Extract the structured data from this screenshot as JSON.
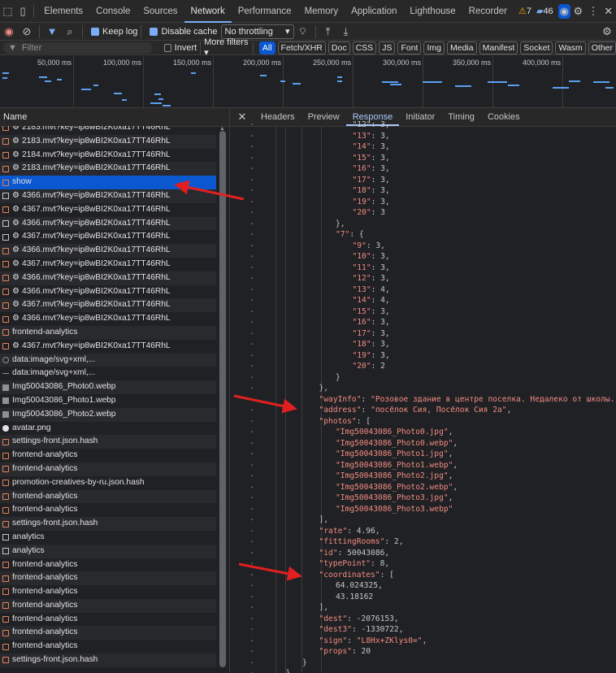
{
  "devtools": {
    "tabs": [
      "Elements",
      "Console",
      "Sources",
      "Network",
      "Performance",
      "Memory",
      "Application",
      "Lighthouse",
      "Recorder"
    ],
    "active_tab": "Network",
    "warnings_count": "7",
    "messages_count": "46"
  },
  "toolbar": {
    "preserve_log": "Keep log",
    "disable_cache": "Disable cache",
    "throttling": "No throttling"
  },
  "filterbar": {
    "placeholder": "Filter",
    "invert": "Invert",
    "more_filters": "More filters",
    "types": [
      "All",
      "Fetch/XHR",
      "Doc",
      "CSS",
      "JS",
      "Font",
      "Img",
      "Media",
      "Manifest",
      "Socket",
      "Wasm",
      "Other"
    ]
  },
  "overview": {
    "ticks": [
      "50,000 ms",
      "100,000 ms",
      "150,000 ms",
      "200,000 ms",
      "250,000 ms",
      "300,000 ms",
      "350,000 ms",
      "400,000 ms"
    ]
  },
  "requests": {
    "header": "Name",
    "rows": [
      {
        "icon": "code",
        "name": "⚙ 2183.mvt?key=ip8wBI2K0xa17TT46RhL"
      },
      {
        "icon": "code",
        "name": "⚙ 2183.mvt?key=ip8wBI2K0xa17TT46RhL"
      },
      {
        "icon": "code",
        "name": "⚙ 2184.mvt?key=ip8wBI2K0xa17TT46RhL"
      },
      {
        "icon": "code",
        "name": "⚙ 2183.mvt?key=ip8wBI2K0xa17TT46RhL"
      },
      {
        "icon": "code",
        "name": "show"
      },
      {
        "icon": "doc",
        "name": "⚙ 4366.mvt?key=ip8wBI2K0xa17TT46RhL"
      },
      {
        "icon": "code",
        "name": "⚙ 4367.mvt?key=ip8wBI2K0xa17TT46RhL"
      },
      {
        "icon": "doc",
        "name": "⚙ 4366.mvt?key=ip8wBI2K0xa17TT46RhL"
      },
      {
        "icon": "doc",
        "name": "⚙ 4367.mvt?key=ip8wBI2K0xa17TT46RhL"
      },
      {
        "icon": "code",
        "name": "⚙ 4366.mvt?key=ip8wBI2K0xa17TT46RhL"
      },
      {
        "icon": "code",
        "name": "⚙ 4367.mvt?key=ip8wBI2K0xa17TT46RhL"
      },
      {
        "icon": "code",
        "name": "⚙ 4366.mvt?key=ip8wBI2K0xa17TT46RhL"
      },
      {
        "icon": "code",
        "name": "⚙ 4366.mvt?key=ip8wBI2K0xa17TT46RhL"
      },
      {
        "icon": "code",
        "name": "⚙ 4367.mvt?key=ip8wBI2K0xa17TT46RhL"
      },
      {
        "icon": "code",
        "name": "⚙ 4366.mvt?key=ip8wBI2K0xa17TT46RhL"
      },
      {
        "icon": "code",
        "name": "frontend-analytics"
      },
      {
        "icon": "code",
        "name": "⚙ 4367.mvt?key=ip8wBI2K0xa17TT46RhL"
      },
      {
        "icon": "data",
        "name": "data:image/svg+xml,..."
      },
      {
        "icon": "dash",
        "name": "data:image/svg+xml,..."
      },
      {
        "icon": "img",
        "name": "Img50043086_Photo0.webp"
      },
      {
        "icon": "img",
        "name": "Img50043086_Photo1.webp"
      },
      {
        "icon": "img",
        "name": "Img50043086_Photo2.webp"
      },
      {
        "icon": "avatar",
        "name": "avatar.png"
      },
      {
        "icon": "code",
        "name": "settings-front.json.hash"
      },
      {
        "icon": "code",
        "name": "frontend-analytics"
      },
      {
        "icon": "code",
        "name": "frontend-analytics"
      },
      {
        "icon": "code",
        "name": "promotion-creatives-by-ru.json.hash"
      },
      {
        "icon": "code",
        "name": "frontend-analytics"
      },
      {
        "icon": "code",
        "name": "frontend-analytics"
      },
      {
        "icon": "code",
        "name": "settings-front.json.hash"
      },
      {
        "icon": "doc",
        "name": "analytics"
      },
      {
        "icon": "doc",
        "name": "analytics"
      },
      {
        "icon": "code",
        "name": "frontend-analytics"
      },
      {
        "icon": "code",
        "name": "frontend-analytics"
      },
      {
        "icon": "code",
        "name": "frontend-analytics"
      },
      {
        "icon": "code",
        "name": "frontend-analytics"
      },
      {
        "icon": "code",
        "name": "frontend-analytics"
      },
      {
        "icon": "code",
        "name": "frontend-analytics"
      },
      {
        "icon": "code",
        "name": "frontend-analytics"
      },
      {
        "icon": "code",
        "name": "settings-front.json.hash"
      }
    ]
  },
  "detail": {
    "tabs": [
      "Headers",
      "Preview",
      "Response",
      "Initiator",
      "Timing",
      "Cookies"
    ],
    "active_tab": "Response",
    "lines": [
      {
        "i": 5,
        "parts": [
          [
            "p",
            "\"12\": 3,"
          ]
        ]
      },
      {
        "i": 5,
        "parts": [
          [
            "s",
            "\"13\""
          ],
          [
            "p",
            ": 3,"
          ]
        ]
      },
      {
        "i": 5,
        "parts": [
          [
            "s",
            "\"14\""
          ],
          [
            "p",
            ": 3,"
          ]
        ]
      },
      {
        "i": 5,
        "parts": [
          [
            "s",
            "\"15\""
          ],
          [
            "p",
            ": 3,"
          ]
        ]
      },
      {
        "i": 5,
        "parts": [
          [
            "s",
            "\"16\""
          ],
          [
            "p",
            ": 3,"
          ]
        ]
      },
      {
        "i": 5,
        "parts": [
          [
            "s",
            "\"17\""
          ],
          [
            "p",
            ": 3,"
          ]
        ]
      },
      {
        "i": 5,
        "parts": [
          [
            "s",
            "\"18\""
          ],
          [
            "p",
            ": 3,"
          ]
        ]
      },
      {
        "i": 5,
        "parts": [
          [
            "s",
            "\"19\""
          ],
          [
            "p",
            ": 3,"
          ]
        ]
      },
      {
        "i": 5,
        "parts": [
          [
            "s",
            "\"20\""
          ],
          [
            "p",
            ": 3"
          ]
        ]
      },
      {
        "i": 4,
        "parts": [
          [
            "p",
            "},"
          ]
        ]
      },
      {
        "i": 4,
        "parts": [
          [
            "s",
            "\"7\""
          ],
          [
            "p",
            ": {"
          ]
        ]
      },
      {
        "i": 5,
        "parts": [
          [
            "s",
            "\"9\""
          ],
          [
            "p",
            ": 3,"
          ]
        ]
      },
      {
        "i": 5,
        "parts": [
          [
            "s",
            "\"10\""
          ],
          [
            "p",
            ": 3,"
          ]
        ]
      },
      {
        "i": 5,
        "parts": [
          [
            "s",
            "\"11\""
          ],
          [
            "p",
            ": 3,"
          ]
        ]
      },
      {
        "i": 5,
        "parts": [
          [
            "s",
            "\"12\""
          ],
          [
            "p",
            ": 3,"
          ]
        ]
      },
      {
        "i": 5,
        "parts": [
          [
            "s",
            "\"13\""
          ],
          [
            "p",
            ": 4,"
          ]
        ]
      },
      {
        "i": 5,
        "parts": [
          [
            "s",
            "\"14\""
          ],
          [
            "p",
            ": 4,"
          ]
        ]
      },
      {
        "i": 5,
        "parts": [
          [
            "s",
            "\"15\""
          ],
          [
            "p",
            ": 3,"
          ]
        ]
      },
      {
        "i": 5,
        "parts": [
          [
            "s",
            "\"16\""
          ],
          [
            "p",
            ": 3,"
          ]
        ]
      },
      {
        "i": 5,
        "parts": [
          [
            "s",
            "\"17\""
          ],
          [
            "p",
            ": 3,"
          ]
        ]
      },
      {
        "i": 5,
        "parts": [
          [
            "s",
            "\"18\""
          ],
          [
            "p",
            ": 3,"
          ]
        ]
      },
      {
        "i": 5,
        "parts": [
          [
            "s",
            "\"19\""
          ],
          [
            "p",
            ": 3,"
          ]
        ]
      },
      {
        "i": 5,
        "parts": [
          [
            "s",
            "\"20\""
          ],
          [
            "p",
            ": 2"
          ]
        ]
      },
      {
        "i": 4,
        "parts": [
          [
            "p",
            "}"
          ]
        ]
      },
      {
        "i": 3,
        "parts": [
          [
            "p",
            "},"
          ]
        ]
      },
      {
        "i": 3,
        "parts": [
          [
            "k",
            "\"wayInfo\""
          ],
          [
            "p",
            ": "
          ],
          [
            "s",
            "\"Розовое здание в центре поселка. Недалеко от школы. Напротив"
          ]
        ]
      },
      {
        "i": 3,
        "parts": [
          [
            "k",
            "\"address\""
          ],
          [
            "p",
            ": "
          ],
          [
            "s",
            "\"посёлок Сия, Посёлок Сия 2а\""
          ],
          [
            "p",
            ","
          ]
        ]
      },
      {
        "i": 3,
        "parts": [
          [
            "k",
            "\"photos\""
          ],
          [
            "p",
            ": ["
          ]
        ]
      },
      {
        "i": 4,
        "parts": [
          [
            "s",
            "\"Img50043086_Photo0.jpg\""
          ],
          [
            "p",
            ","
          ]
        ]
      },
      {
        "i": 4,
        "parts": [
          [
            "s",
            "\"Img50043086_Photo0.webp\""
          ],
          [
            "p",
            ","
          ]
        ]
      },
      {
        "i": 4,
        "parts": [
          [
            "s",
            "\"Img50043086_Photo1.jpg\""
          ],
          [
            "p",
            ","
          ]
        ]
      },
      {
        "i": 4,
        "parts": [
          [
            "s",
            "\"Img50043086_Photo1.webp\""
          ],
          [
            "p",
            ","
          ]
        ]
      },
      {
        "i": 4,
        "parts": [
          [
            "s",
            "\"Img50043086_Photo2.jpg\""
          ],
          [
            "p",
            ","
          ]
        ]
      },
      {
        "i": 4,
        "parts": [
          [
            "s",
            "\"Img50043086_Photo2.webp\""
          ],
          [
            "p",
            ","
          ]
        ]
      },
      {
        "i": 4,
        "parts": [
          [
            "s",
            "\"Img50043086_Photo3.jpg\""
          ],
          [
            "p",
            ","
          ]
        ]
      },
      {
        "i": 4,
        "parts": [
          [
            "s",
            "\"Img50043086_Photo3.webp\""
          ]
        ]
      },
      {
        "i": 3,
        "parts": [
          [
            "p",
            "],"
          ]
        ]
      },
      {
        "i": 3,
        "parts": [
          [
            "k",
            "\"rate\""
          ],
          [
            "p",
            ": 4.96,"
          ]
        ]
      },
      {
        "i": 3,
        "parts": [
          [
            "k",
            "\"fittingRooms\""
          ],
          [
            "p",
            ": 2,"
          ]
        ]
      },
      {
        "i": 3,
        "parts": [
          [
            "k",
            "\"id\""
          ],
          [
            "p",
            ": 50043086,"
          ]
        ]
      },
      {
        "i": 3,
        "parts": [
          [
            "k",
            "\"typePoint\""
          ],
          [
            "p",
            ": 8,"
          ]
        ]
      },
      {
        "i": 3,
        "parts": [
          [
            "k",
            "\"coordinates\""
          ],
          [
            "p",
            ": ["
          ]
        ]
      },
      {
        "i": 4,
        "parts": [
          [
            "p",
            "64.024325,"
          ]
        ]
      },
      {
        "i": 4,
        "parts": [
          [
            "p",
            "43.18162"
          ]
        ]
      },
      {
        "i": 3,
        "parts": [
          [
            "p",
            "],"
          ]
        ]
      },
      {
        "i": 3,
        "parts": [
          [
            "k",
            "\"dest\""
          ],
          [
            "p",
            ": -2076153,"
          ]
        ]
      },
      {
        "i": 3,
        "parts": [
          [
            "k",
            "\"dest3\""
          ],
          [
            "p",
            ": -1330722,"
          ]
        ]
      },
      {
        "i": 3,
        "parts": [
          [
            "k",
            "\"sign\""
          ],
          [
            "p",
            ": "
          ],
          [
            "s",
            "\"L8Hx+ZKlys0=\""
          ],
          [
            "p",
            ","
          ]
        ]
      },
      {
        "i": 3,
        "parts": [
          [
            "k",
            "\"props\""
          ],
          [
            "p",
            ": 20"
          ]
        ]
      },
      {
        "i": 2,
        "parts": [
          [
            "p",
            "}"
          ]
        ]
      },
      {
        "i": 1,
        "parts": [
          [
            "p",
            "}"
          ]
        ]
      }
    ]
  },
  "colors": {
    "accent": "#7cacf8",
    "arrow": "#e02020",
    "selected_row": "#0b57d0"
  }
}
